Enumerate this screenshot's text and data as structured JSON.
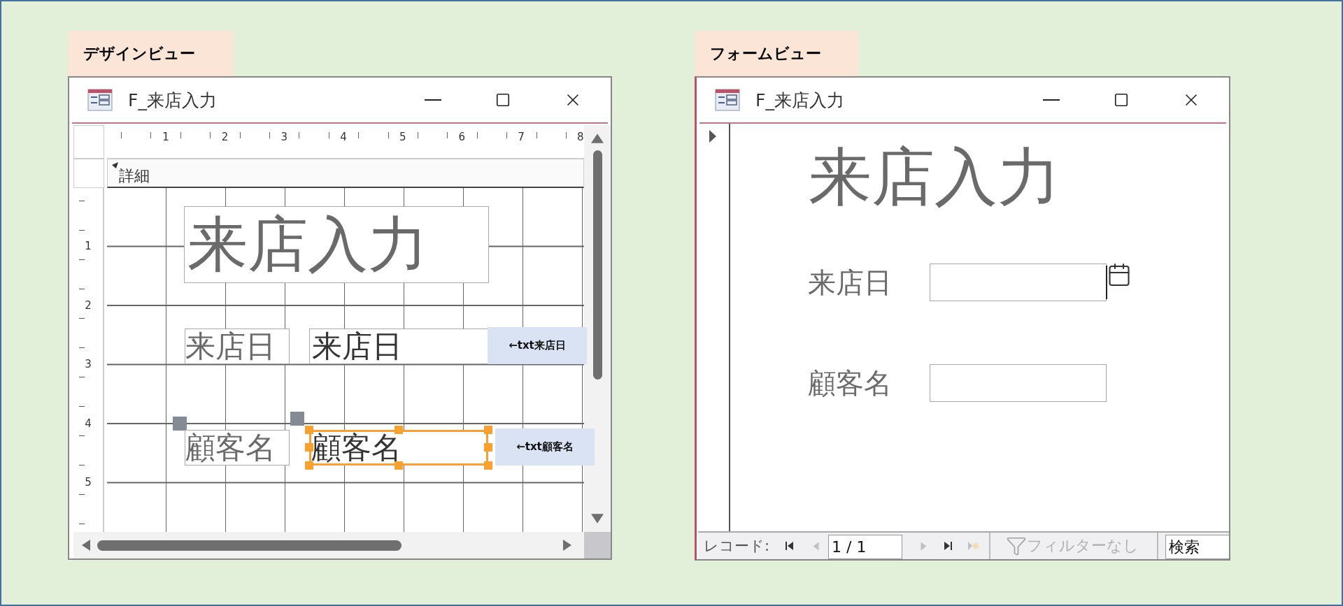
{
  "design_view": {
    "label": "デザインビュー",
    "window": {
      "title": "F_来店入力"
    },
    "ruler_marks": [
      "1",
      "2",
      "3",
      "4",
      "5",
      "6",
      "7",
      "8"
    ],
    "vertical_ruler_marks": [
      "1",
      "2",
      "3",
      "4",
      "5"
    ],
    "section": "詳細",
    "title_label": "来店入力",
    "fields": [
      {
        "label": "来店日",
        "control_text": "来店日",
        "selected": false,
        "note": "←txt来店日"
      },
      {
        "label": "顧客名",
        "control_text": "顧客名",
        "selected": true,
        "note": "←txt顧客名"
      }
    ]
  },
  "form_view": {
    "label": "フォームビュー",
    "window": {
      "title": "F_来店入力"
    },
    "title_label": "来店入力",
    "fields": [
      {
        "label": "来店日",
        "kind": "date"
      },
      {
        "label": "顧客名",
        "kind": "text"
      }
    ],
    "navigation": {
      "label": "レコード:",
      "position": "1 / 1",
      "buttons": [
        {
          "kind": "first",
          "disabled": false
        },
        {
          "kind": "previous",
          "disabled": true
        }
      ],
      "buttons_after": [
        {
          "kind": "next",
          "disabled": true
        },
        {
          "kind": "last",
          "disabled": false
        },
        {
          "kind": "new",
          "disabled": true
        }
      ],
      "filter": {
        "text": "フィルターなし",
        "disabled": true
      },
      "search_placeholder": "検索"
    }
  }
}
